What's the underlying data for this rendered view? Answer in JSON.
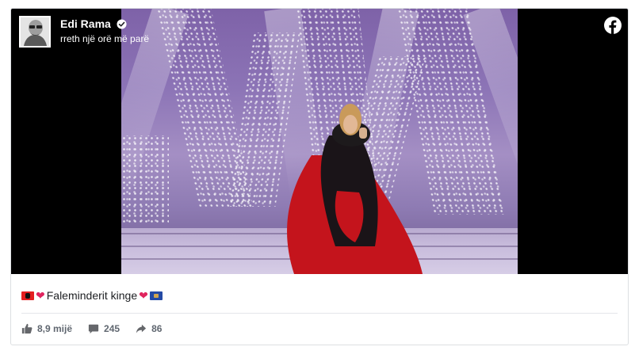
{
  "post": {
    "author": "Edi Rama",
    "timestamp": "rreth një orë më parë",
    "caption_text": "Faleminderit kinge",
    "stats": {
      "likes": "8,9 mijë",
      "comments": "245",
      "shares": "86"
    }
  },
  "icons": {
    "verified": "verified-badge-icon",
    "platform": "facebook-icon",
    "like": "like-icon",
    "comment": "comment-icon",
    "share": "share-icon"
  },
  "colors": {
    "flag_red": "#e41e20",
    "heart": "#e0245e",
    "meta_text": "#606770"
  }
}
